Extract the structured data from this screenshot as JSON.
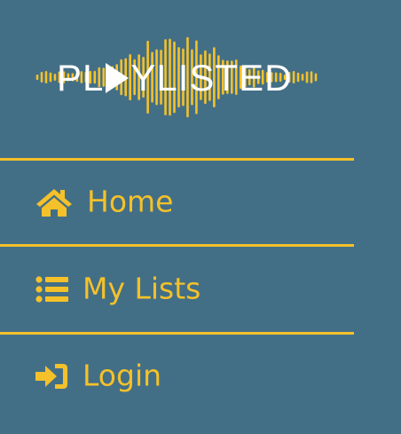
{
  "logo": {
    "text_before": "PL",
    "text_after": "YLISTED",
    "play_icon": "play-triangle-icon",
    "wave_icon": "sound-wave-icon"
  },
  "nav": {
    "items": [
      {
        "label": "Home",
        "icon": "home-icon"
      },
      {
        "label": "My Lists",
        "icon": "list-icon"
      },
      {
        "label": "Login",
        "icon": "sign-in-icon"
      }
    ]
  },
  "colors": {
    "background": "#436f86",
    "accent": "#f5c12a",
    "logo_text": "#ffffff"
  }
}
